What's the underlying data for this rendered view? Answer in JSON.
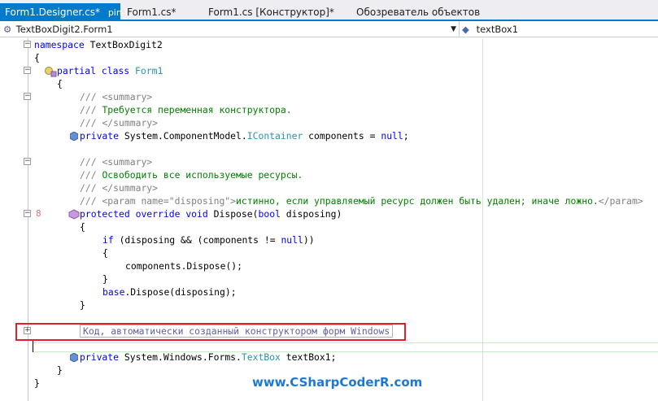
{
  "tabs": [
    {
      "label": "Form1.Designer.cs*",
      "icon": "pin-icon ✕",
      "active": true
    },
    {
      "label": "Form1.cs*",
      "active": false
    },
    {
      "label": "Form1.cs [Конструктор]*",
      "active": false
    },
    {
      "label": "Обозреватель объектов",
      "active": false
    }
  ],
  "nav": {
    "class_select": "TextBoxDigit2.Form1",
    "member_select": "textBox1"
  },
  "code": {
    "l1_kw": "namespace",
    "l1_name": " TextBoxDigit2",
    "l2": "{",
    "l3_kw1": "partial",
    "l3_kw2": " class",
    "l3_type": " Form1",
    "l4": "{",
    "l5_a": "/// ",
    "l5_b": "<summary>",
    "l6_a": "/// ",
    "l6_b": "Требуется переменная конструктора.",
    "l7_a": "/// ",
    "l7_b": "</summary>",
    "l8_kw": "private",
    "l8_ns": " System.ComponentModel.",
    "l8_type": "IContainer",
    "l8_rest": " components = ",
    "l8_null": "null",
    "l8_end": ";",
    "l9_a": "/// ",
    "l9_b": "<summary>",
    "l10_a": "/// ",
    "l10_b": "Освободить все используемые ресурсы.",
    "l11_a": "/// ",
    "l11_b": "</summary>",
    "l12_a": "/// ",
    "l12_b": "<param name=\"disposing\">",
    "l12_c": "истинно, если управляемый ресурс должен быть удален; иначе ложно.",
    "l12_d": "</param>",
    "l13_num": "8",
    "l13_kw1": "protected",
    "l13_kw2": " override",
    "l13_kw3": " void",
    "l13_name": " Dispose(",
    "l13_kw4": "bool",
    "l13_end": " disposing)",
    "l14": "{",
    "l15_kw": "if",
    "l15_a": " (disposing && (components != ",
    "l15_null": "null",
    "l15_end": "))",
    "l16": "{",
    "l17": "components.Dispose();",
    "l18": "}",
    "l19_kw": "base",
    "l19_rest": ".Dispose(disposing);",
    "l20": "}",
    "region": "Код, автоматически созданный конструктором форм Windows",
    "l22_kw": "private",
    "l22_ns": " System.Windows.Forms.",
    "l22_type": "TextBox",
    "l22_rest": " textBox1;",
    "l23": "}",
    "l24": "}"
  },
  "watermark": "www.CSharpCoderR.com",
  "colors": {
    "accent": "#007acc",
    "highlight_frame": "#e0202a",
    "keyword": "#0000ff",
    "type": "#2b91af",
    "comment": "#008000"
  }
}
